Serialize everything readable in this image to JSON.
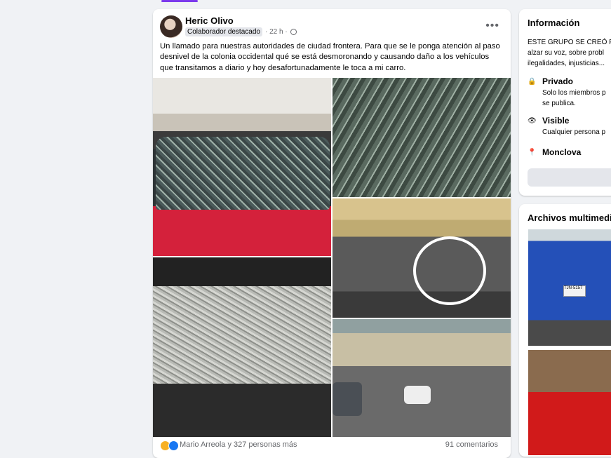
{
  "post": {
    "author": "Heric Olivo",
    "badge": "Colaborador destacado",
    "time": "· 22 h ·",
    "text": "Un llamado para nuestras autoridades de ciudad frontera.  Para que se le ponga atención al paso desnivel de la colonia occidental qué se está desmoronando y causando daño a los vehículos que transitamos a diario y hoy desafortunadamente le toca a mi carro.",
    "reactions_text": "Mario Arreola y 327 personas más",
    "comments": "91 comentarios"
  },
  "sidebar_info": {
    "title": "Información",
    "desc_lines": [
      "ESTE GRUPO SE CREÓ PA",
      "alzar su voz, sobre probl",
      "ilegalidades, injusticias..."
    ],
    "private_title": "Privado",
    "private_lines": [
      "Solo los miembros p",
      "se publica."
    ],
    "visible_title": "Visible",
    "visible_line": "Cualquier persona p",
    "location": "Monclova"
  },
  "sidebar_media": {
    "title": "Archivos multimedia",
    "plate": "TJN-5157"
  },
  "icons": [
    "more-icon",
    "globe-icon",
    "lock-icon",
    "eye-icon",
    "location-pin-icon",
    "wow-reaction-icon",
    "like-reaction-icon"
  ]
}
